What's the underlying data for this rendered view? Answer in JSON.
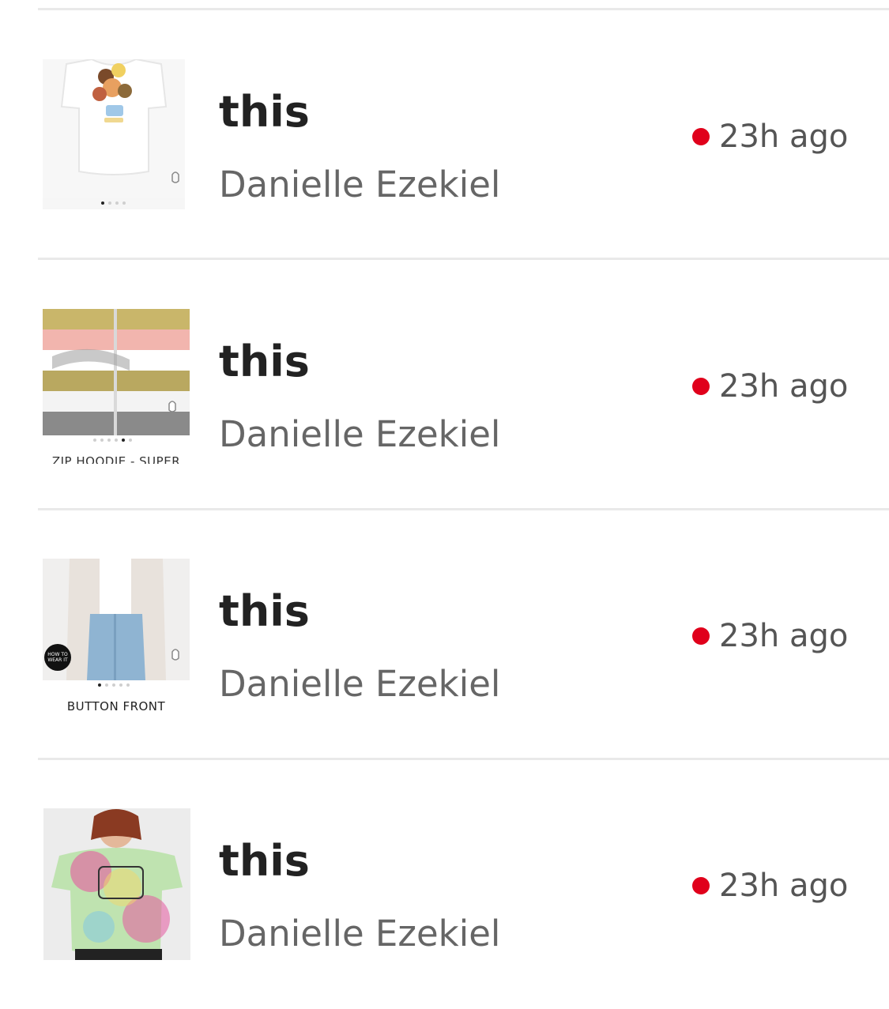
{
  "colors": {
    "unread_dot": "#e0001b",
    "title": "#222222",
    "author": "#666666",
    "time": "#555555",
    "divider": "#e9e9e9"
  },
  "items": [
    {
      "title": "this",
      "author": "Danielle Ezekiel",
      "time": "23h ago",
      "thumb_caption": "",
      "thumb_badge": ""
    },
    {
      "title": "this",
      "author": "Danielle Ezekiel",
      "time": "23h ago",
      "thumb_caption": "ZIP HOODIE - SUPER",
      "thumb_badge": ""
    },
    {
      "title": "this",
      "author": "Danielle Ezekiel",
      "time": "23h ago",
      "thumb_caption": "BUTTON FRONT",
      "thumb_badge": "HOW TO WEAR IT"
    },
    {
      "title": "this",
      "author": "Danielle Ezekiel",
      "time": "23h ago",
      "thumb_caption": "",
      "thumb_badge": ""
    }
  ]
}
